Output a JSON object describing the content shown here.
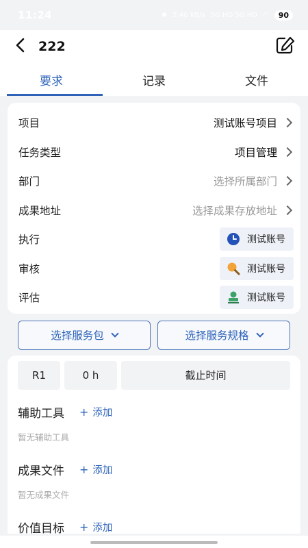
{
  "status": {
    "time": "11:24",
    "net": "2.40 KB/s",
    "signal": "5G HD 5G HD",
    "battery": "90"
  },
  "header": {
    "title": "222"
  },
  "tabs": [
    {
      "label": "要求",
      "active": true
    },
    {
      "label": "记录",
      "active": false
    },
    {
      "label": "文件",
      "active": false
    }
  ],
  "form": {
    "project": {
      "label": "项目",
      "value": "测试账号项目"
    },
    "task_type": {
      "label": "任务类型",
      "value": "项目管理"
    },
    "department": {
      "label": "部门",
      "value": "选择所属部门"
    },
    "result_addr": {
      "label": "成果地址",
      "value": "选择成果存放地址"
    },
    "execute": {
      "label": "执行",
      "value": "测试账号",
      "icon": "clock-icon"
    },
    "review": {
      "label": "审核",
      "value": "测试账号",
      "icon": "magnifier-icon"
    },
    "evaluate": {
      "label": "评估",
      "value": "测试账号",
      "icon": "stamp-icon"
    }
  },
  "selectors": {
    "service_pack": "选择服务包",
    "service_spec": "选择服务规格"
  },
  "stats": {
    "round": "R1",
    "hours": "0 h",
    "deadline": "截止时间"
  },
  "sections": {
    "tools": {
      "title": "辅助工具",
      "add": "添加",
      "empty": "暂无辅助工具"
    },
    "files": {
      "title": "成果文件",
      "add": "添加",
      "empty": "暂无成果文件"
    },
    "goal": {
      "title": "价值目标",
      "add": "添加"
    }
  },
  "colors": {
    "accent": "#2e63b8",
    "bg": "#f2f3f5"
  }
}
